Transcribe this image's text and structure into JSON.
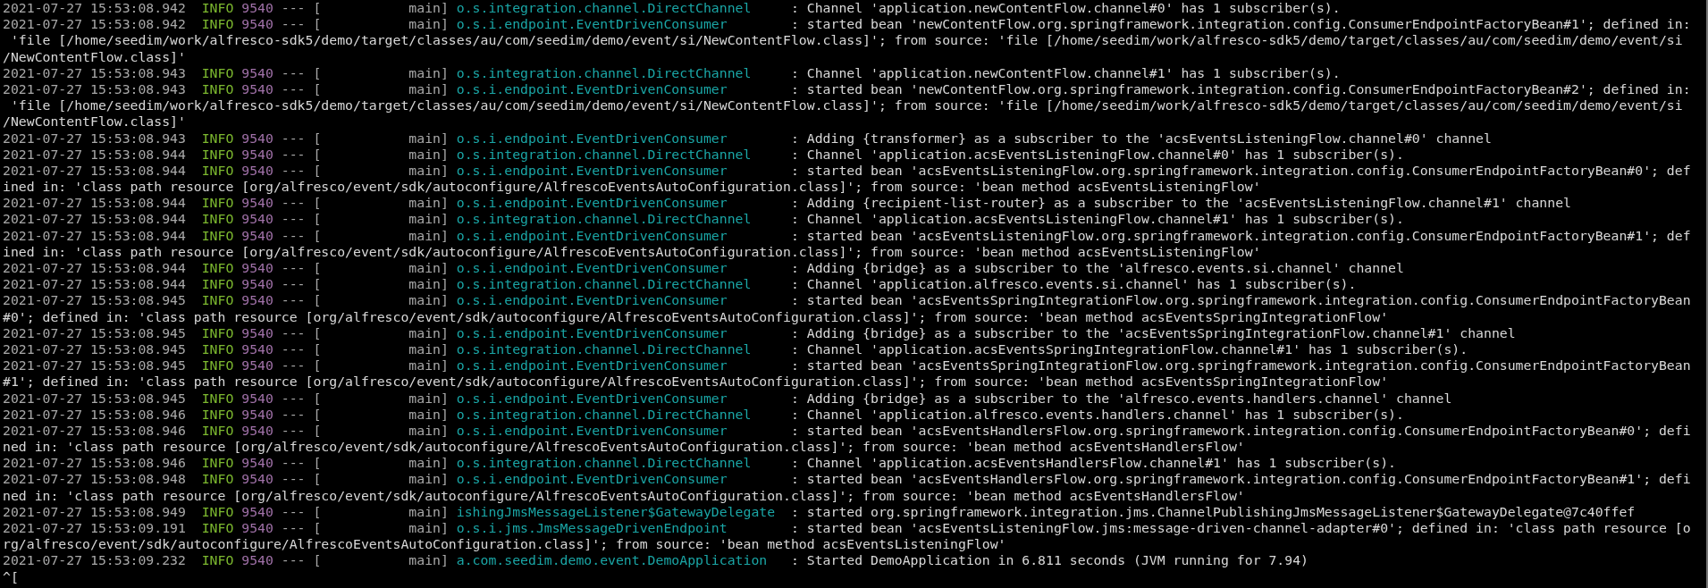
{
  "terminal": {
    "lines": [
      {
        "kind": "log",
        "time": "2021-07-27 15:53:08.942",
        "level": "INFO",
        "pid": "9540",
        "separator": "---",
        "thread": "[           main]",
        "logger": "o.s.integration.channel.DirectChannel",
        "message": ": Channel 'application.newContentFlow.channel#0' has 1 subscriber(s)."
      },
      {
        "kind": "log",
        "time": "2021-07-27 15:53:08.942",
        "level": "INFO",
        "pid": "9540",
        "separator": "---",
        "thread": "[           main]",
        "logger": "o.s.i.endpoint.EventDrivenConsumer",
        "message": ": started bean 'newContentFlow.org.springframework.integration.config.ConsumerEndpointFactoryBean#1'; defined in:"
      },
      {
        "kind": "wrap",
        "text": " 'file [/home/seedim/work/alfresco-sdk5/demo/target/classes/au/com/seedim/demo/event/si/NewContentFlow.class]'; from source: 'file [/home/seedim/work/alfresco-sdk5/demo/target/classes/au/com/seedim/demo/event/si"
      },
      {
        "kind": "wrap",
        "text": "/NewContentFlow.class]'"
      },
      {
        "kind": "log",
        "time": "2021-07-27 15:53:08.943",
        "level": "INFO",
        "pid": "9540",
        "separator": "---",
        "thread": "[           main]",
        "logger": "o.s.integration.channel.DirectChannel",
        "message": ": Channel 'application.newContentFlow.channel#1' has 1 subscriber(s)."
      },
      {
        "kind": "log",
        "time": "2021-07-27 15:53:08.943",
        "level": "INFO",
        "pid": "9540",
        "separator": "---",
        "thread": "[           main]",
        "logger": "o.s.i.endpoint.EventDrivenConsumer",
        "message": ": started bean 'newContentFlow.org.springframework.integration.config.ConsumerEndpointFactoryBean#2'; defined in:"
      },
      {
        "kind": "wrap",
        "text": " 'file [/home/seedim/work/alfresco-sdk5/demo/target/classes/au/com/seedim/demo/event/si/NewContentFlow.class]'; from source: 'file [/home/seedim/work/alfresco-sdk5/demo/target/classes/au/com/seedim/demo/event/si"
      },
      {
        "kind": "wrap",
        "text": "/NewContentFlow.class]'"
      },
      {
        "kind": "log",
        "time": "2021-07-27 15:53:08.943",
        "level": "INFO",
        "pid": "9540",
        "separator": "---",
        "thread": "[           main]",
        "logger": "o.s.i.endpoint.EventDrivenConsumer",
        "message": ": Adding {transformer} as a subscriber to the 'acsEventsListeningFlow.channel#0' channel"
      },
      {
        "kind": "log",
        "time": "2021-07-27 15:53:08.944",
        "level": "INFO",
        "pid": "9540",
        "separator": "---",
        "thread": "[           main]",
        "logger": "o.s.integration.channel.DirectChannel",
        "message": ": Channel 'application.acsEventsListeningFlow.channel#0' has 1 subscriber(s)."
      },
      {
        "kind": "log",
        "time": "2021-07-27 15:53:08.944",
        "level": "INFO",
        "pid": "9540",
        "separator": "---",
        "thread": "[           main]",
        "logger": "o.s.i.endpoint.EventDrivenConsumer",
        "message": ": started bean 'acsEventsListeningFlow.org.springframework.integration.config.ConsumerEndpointFactoryBean#0'; def"
      },
      {
        "kind": "wrap",
        "text": "ined in: 'class path resource [org/alfresco/event/sdk/autoconfigure/AlfrescoEventsAutoConfiguration.class]'; from source: 'bean method acsEventsListeningFlow'"
      },
      {
        "kind": "log",
        "time": "2021-07-27 15:53:08.944",
        "level": "INFO",
        "pid": "9540",
        "separator": "---",
        "thread": "[           main]",
        "logger": "o.s.i.endpoint.EventDrivenConsumer",
        "message": ": Adding {recipient-list-router} as a subscriber to the 'acsEventsListeningFlow.channel#1' channel"
      },
      {
        "kind": "log",
        "time": "2021-07-27 15:53:08.944",
        "level": "INFO",
        "pid": "9540",
        "separator": "---",
        "thread": "[           main]",
        "logger": "o.s.integration.channel.DirectChannel",
        "message": ": Channel 'application.acsEventsListeningFlow.channel#1' has 1 subscriber(s)."
      },
      {
        "kind": "log",
        "time": "2021-07-27 15:53:08.944",
        "level": "INFO",
        "pid": "9540",
        "separator": "---",
        "thread": "[           main]",
        "logger": "o.s.i.endpoint.EventDrivenConsumer",
        "message": ": started bean 'acsEventsListeningFlow.org.springframework.integration.config.ConsumerEndpointFactoryBean#1'; def"
      },
      {
        "kind": "wrap",
        "text": "ined in: 'class path resource [org/alfresco/event/sdk/autoconfigure/AlfrescoEventsAutoConfiguration.class]'; from source: 'bean method acsEventsListeningFlow'"
      },
      {
        "kind": "log",
        "time": "2021-07-27 15:53:08.944",
        "level": "INFO",
        "pid": "9540",
        "separator": "---",
        "thread": "[           main]",
        "logger": "o.s.i.endpoint.EventDrivenConsumer",
        "message": ": Adding {bridge} as a subscriber to the 'alfresco.events.si.channel' channel"
      },
      {
        "kind": "log",
        "time": "2021-07-27 15:53:08.944",
        "level": "INFO",
        "pid": "9540",
        "separator": "---",
        "thread": "[           main]",
        "logger": "o.s.integration.channel.DirectChannel",
        "message": ": Channel 'application.alfresco.events.si.channel' has 1 subscriber(s)."
      },
      {
        "kind": "log",
        "time": "2021-07-27 15:53:08.945",
        "level": "INFO",
        "pid": "9540",
        "separator": "---",
        "thread": "[           main]",
        "logger": "o.s.i.endpoint.EventDrivenConsumer",
        "message": ": started bean 'acsEventsSpringIntegrationFlow.org.springframework.integration.config.ConsumerEndpointFactoryBean"
      },
      {
        "kind": "wrap",
        "text": "#0'; defined in: 'class path resource [org/alfresco/event/sdk/autoconfigure/AlfrescoEventsAutoConfiguration.class]'; from source: 'bean method acsEventsSpringIntegrationFlow'"
      },
      {
        "kind": "log",
        "time": "2021-07-27 15:53:08.945",
        "level": "INFO",
        "pid": "9540",
        "separator": "---",
        "thread": "[           main]",
        "logger": "o.s.i.endpoint.EventDrivenConsumer",
        "message": ": Adding {bridge} as a subscriber to the 'acsEventsSpringIntegrationFlow.channel#1' channel"
      },
      {
        "kind": "log",
        "time": "2021-07-27 15:53:08.945",
        "level": "INFO",
        "pid": "9540",
        "separator": "---",
        "thread": "[           main]",
        "logger": "o.s.integration.channel.DirectChannel",
        "message": ": Channel 'application.acsEventsSpringIntegrationFlow.channel#1' has 1 subscriber(s)."
      },
      {
        "kind": "log",
        "time": "2021-07-27 15:53:08.945",
        "level": "INFO",
        "pid": "9540",
        "separator": "---",
        "thread": "[           main]",
        "logger": "o.s.i.endpoint.EventDrivenConsumer",
        "message": ": started bean 'acsEventsSpringIntegrationFlow.org.springframework.integration.config.ConsumerEndpointFactoryBean"
      },
      {
        "kind": "wrap",
        "text": "#1'; defined in: 'class path resource [org/alfresco/event/sdk/autoconfigure/AlfrescoEventsAutoConfiguration.class]'; from source: 'bean method acsEventsSpringIntegrationFlow'"
      },
      {
        "kind": "log",
        "time": "2021-07-27 15:53:08.945",
        "level": "INFO",
        "pid": "9540",
        "separator": "---",
        "thread": "[           main]",
        "logger": "o.s.i.endpoint.EventDrivenConsumer",
        "message": ": Adding {bridge} as a subscriber to the 'alfresco.events.handlers.channel' channel"
      },
      {
        "kind": "log",
        "time": "2021-07-27 15:53:08.946",
        "level": "INFO",
        "pid": "9540",
        "separator": "---",
        "thread": "[           main]",
        "logger": "o.s.integration.channel.DirectChannel",
        "message": ": Channel 'application.alfresco.events.handlers.channel' has 1 subscriber(s)."
      },
      {
        "kind": "log",
        "time": "2021-07-27 15:53:08.946",
        "level": "INFO",
        "pid": "9540",
        "separator": "---",
        "thread": "[           main]",
        "logger": "o.s.i.endpoint.EventDrivenConsumer",
        "message": ": started bean 'acsEventsHandlersFlow.org.springframework.integration.config.ConsumerEndpointFactoryBean#0'; defi"
      },
      {
        "kind": "wrap",
        "text": "ned in: 'class path resource [org/alfresco/event/sdk/autoconfigure/AlfrescoEventsAutoConfiguration.class]'; from source: 'bean method acsEventsHandlersFlow'"
      },
      {
        "kind": "log",
        "time": "2021-07-27 15:53:08.946",
        "level": "INFO",
        "pid": "9540",
        "separator": "---",
        "thread": "[           main]",
        "logger": "o.s.integration.channel.DirectChannel",
        "message": ": Channel 'application.acsEventsHandlersFlow.channel#1' has 1 subscriber(s)."
      },
      {
        "kind": "log",
        "time": "2021-07-27 15:53:08.948",
        "level": "INFO",
        "pid": "9540",
        "separator": "---",
        "thread": "[           main]",
        "logger": "o.s.i.endpoint.EventDrivenConsumer",
        "message": ": started bean 'acsEventsHandlersFlow.org.springframework.integration.config.ConsumerEndpointFactoryBean#1'; defi"
      },
      {
        "kind": "wrap",
        "text": "ned in: 'class path resource [org/alfresco/event/sdk/autoconfigure/AlfrescoEventsAutoConfiguration.class]'; from source: 'bean method acsEventsHandlersFlow'"
      },
      {
        "kind": "log",
        "time": "2021-07-27 15:53:08.949",
        "level": "INFO",
        "pid": "9540",
        "separator": "---",
        "thread": "[           main]",
        "logger": "ishingJmsMessageListener$GatewayDelegate",
        "message": ": started org.springframework.integration.jms.ChannelPublishingJmsMessageListener$GatewayDelegate@7c40ffef"
      },
      {
        "kind": "log",
        "time": "2021-07-27 15:53:09.191",
        "level": "INFO",
        "pid": "9540",
        "separator": "---",
        "thread": "[           main]",
        "logger": "o.s.i.jms.JmsMessageDrivenEndpoint",
        "message": ": started bean 'acsEventsListeningFlow.jms:message-driven-channel-adapter#0'; defined in: 'class path resource [o"
      },
      {
        "kind": "wrap",
        "text": "rg/alfresco/event/sdk/autoconfigure/AlfrescoEventsAutoConfiguration.class]'; from source: 'bean method acsEventsListeningFlow'"
      },
      {
        "kind": "log",
        "time": "2021-07-27 15:53:09.232",
        "level": "INFO",
        "pid": "9540",
        "separator": "---",
        "thread": "[           main]",
        "logger": "a.com.seedim.demo.event.DemoApplication",
        "message": ": Started DemoApplication in 6.811 seconds (JVM running for 7.94)"
      },
      {
        "kind": "prompt",
        "text": "^["
      }
    ]
  }
}
